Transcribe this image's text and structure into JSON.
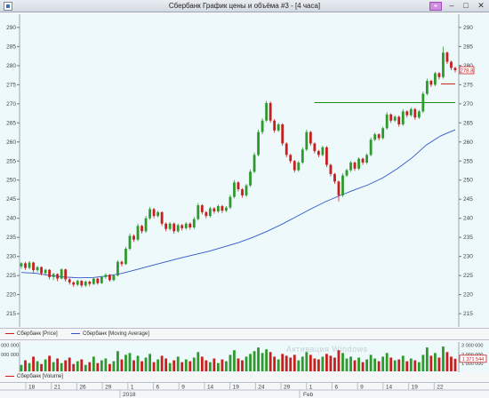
{
  "window": {
    "title": "Сбербанк График цены и объёма #3 - [4 часа]",
    "pin_icon": "pin-icon",
    "buttons": {
      "minimize": "–",
      "maximize": "□",
      "close": "✕"
    }
  },
  "colors": {
    "background": "#edf9fb",
    "up": "#2e9a2e",
    "down": "#c81e1e",
    "moving_average": "#3355cc",
    "level_line": "#1a8a1a",
    "price_label": "#c81e1e"
  },
  "legend": {
    "price": "Сбербанк [Price]",
    "moving_average": "Сбербанк [Moving Average]",
    "volume": "Сбербанк [Volume]"
  },
  "watermark": "Активация Windows",
  "price_axis": {
    "ticks": [
      "290",
      "285",
      "280",
      "275",
      "270",
      "265",
      "260",
      "255",
      "250",
      "245",
      "240",
      "235",
      "230",
      "225",
      "220",
      "215"
    ],
    "current_price": "278.8"
  },
  "volume_axis": {
    "right_ticks": [
      "3 000 000",
      "2 000 000",
      "1 000 000"
    ],
    "left_ticks": [
      "3 000 000",
      "2 000 000"
    ],
    "current_volume": "1 371 544"
  },
  "time_axis": {
    "day_labels": [
      "18",
      "21",
      "26",
      "29",
      "1",
      "6",
      "9",
      "14",
      "19",
      "24",
      "29",
      "1",
      "6",
      "9",
      "14",
      "19",
      "22"
    ],
    "year_label": "2018",
    "month_label": "Feb"
  },
  "chart_data": [
    {
      "type": "candlestick",
      "title": "",
      "ylim": [
        212,
        293
      ],
      "moving_average": [
        [
          0,
          225.8
        ],
        [
          10,
          225.6
        ],
        [
          20,
          225.0
        ],
        [
          30,
          224.6
        ],
        [
          40,
          224.4
        ],
        [
          50,
          224.5
        ],
        [
          60,
          224.9
        ],
        [
          70,
          225.6
        ],
        [
          80,
          226.6
        ],
        [
          90,
          227.6
        ],
        [
          100,
          228.6
        ],
        [
          110,
          229.6
        ],
        [
          120,
          230.5
        ],
        [
          130,
          231.4
        ],
        [
          140,
          232.5
        ],
        [
          150,
          233.6
        ],
        [
          160,
          235.0
        ],
        [
          170,
          236.6
        ],
        [
          180,
          238.4
        ],
        [
          190,
          240.4
        ],
        [
          200,
          242.4
        ],
        [
          210,
          244.3
        ],
        [
          220,
          245.9
        ],
        [
          230,
          247.4
        ],
        [
          240,
          248.8
        ],
        [
          250,
          250.6
        ],
        [
          260,
          253.0
        ],
        [
          270,
          255.8
        ],
        [
          280,
          259.2
        ],
        [
          290,
          261.6
        ],
        [
          300,
          263.2
        ]
      ],
      "levels": [
        {
          "from": 206,
          "to": 305,
          "value": 270.3
        },
        {
          "from": 295,
          "to": 305,
          "value": 275.2
        }
      ],
      "candles": [
        [
          0,
          227.4,
          228.2,
          226.8,
          228.5
        ],
        [
          1,
          228.2,
          227.0,
          226.5,
          228.6
        ],
        [
          2,
          227.0,
          228.4,
          226.6,
          228.8
        ],
        [
          3,
          228.4,
          226.4,
          225.8,
          228.6
        ],
        [
          4,
          226.4,
          227.2,
          225.9,
          227.5
        ],
        [
          5,
          227.2,
          225.6,
          225.0,
          227.4
        ],
        [
          6,
          225.6,
          226.5,
          225.0,
          226.8
        ],
        [
          7,
          226.5,
          224.6,
          224.0,
          226.7
        ],
        [
          8,
          224.6,
          225.4,
          223.8,
          225.7
        ],
        [
          9,
          225.4,
          224.2,
          223.5,
          225.6
        ],
        [
          10,
          224.2,
          226.6,
          224.0,
          226.9
        ],
        [
          11,
          226.6,
          224.0,
          223.4,
          226.8
        ],
        [
          12,
          224.0,
          223.2,
          222.6,
          224.3
        ],
        [
          13,
          223.2,
          222.6,
          222.0,
          223.5
        ],
        [
          14,
          222.6,
          223.6,
          222.2,
          223.9
        ],
        [
          15,
          223.6,
          222.4,
          221.9,
          223.8
        ],
        [
          16,
          222.4,
          223.4,
          222.0,
          223.7
        ],
        [
          17,
          223.4,
          222.8,
          222.2,
          223.6
        ],
        [
          18,
          222.8,
          224.2,
          222.5,
          224.5
        ],
        [
          19,
          224.2,
          223.0,
          222.6,
          224.4
        ],
        [
          20,
          223.0,
          224.6,
          222.8,
          224.9
        ],
        [
          21,
          224.6,
          225.2,
          224.1,
          225.6
        ],
        [
          22,
          225.2,
          223.8,
          223.4,
          225.4
        ],
        [
          23,
          223.8,
          225.0,
          223.5,
          225.3
        ],
        [
          24,
          225.0,
          228.6,
          224.8,
          229.0
        ],
        [
          25,
          228.6,
          228.0,
          227.4,
          228.9
        ],
        [
          26,
          228.0,
          232.0,
          227.8,
          232.5
        ],
        [
          27,
          232.0,
          235.4,
          231.6,
          236.0
        ],
        [
          28,
          235.4,
          234.4,
          233.8,
          235.8
        ],
        [
          29,
          234.4,
          238.0,
          234.0,
          238.6
        ],
        [
          30,
          238.0,
          236.6,
          236.0,
          238.3
        ],
        [
          31,
          236.6,
          240.0,
          236.2,
          240.6
        ],
        [
          32,
          240.0,
          242.4,
          239.6,
          243.0
        ],
        [
          33,
          242.4,
          240.6,
          240.0,
          242.7
        ],
        [
          34,
          240.6,
          241.6,
          240.2,
          242.0
        ],
        [
          35,
          241.6,
          238.6,
          238.0,
          241.8
        ],
        [
          36,
          238.6,
          237.2,
          236.6,
          238.9
        ],
        [
          37,
          237.2,
          238.6,
          236.8,
          239.0
        ],
        [
          38,
          238.6,
          236.6,
          236.0,
          238.9
        ],
        [
          39,
          236.6,
          238.2,
          236.2,
          238.6
        ],
        [
          40,
          238.2,
          237.4,
          236.8,
          238.5
        ],
        [
          41,
          237.4,
          238.6,
          237.0,
          239.0
        ],
        [
          42,
          238.6,
          237.6,
          237.0,
          238.9
        ],
        [
          43,
          237.6,
          239.8,
          237.2,
          240.3
        ],
        [
          44,
          239.8,
          243.4,
          239.4,
          244.0
        ],
        [
          45,
          243.4,
          241.6,
          241.0,
          243.7
        ],
        [
          46,
          241.6,
          240.6,
          240.0,
          241.9
        ],
        [
          47,
          240.6,
          242.6,
          240.2,
          243.0
        ],
        [
          48,
          242.6,
          241.8,
          241.2,
          242.9
        ],
        [
          49,
          241.8,
          243.2,
          241.4,
          243.6
        ],
        [
          50,
          243.2,
          242.0,
          241.4,
          243.5
        ],
        [
          51,
          242.0,
          242.8,
          241.6,
          243.2
        ],
        [
          52,
          242.8,
          245.6,
          242.4,
          246.2
        ],
        [
          53,
          245.6,
          249.4,
          245.2,
          250.0
        ],
        [
          54,
          249.4,
          247.6,
          247.0,
          249.7
        ],
        [
          55,
          247.6,
          246.0,
          245.4,
          247.9
        ],
        [
          56,
          246.0,
          248.6,
          245.6,
          249.0
        ],
        [
          57,
          248.6,
          252.2,
          248.2,
          252.8
        ],
        [
          58,
          252.2,
          256.6,
          251.8,
          257.2
        ],
        [
          59,
          256.6,
          262.6,
          256.2,
          263.2
        ],
        [
          60,
          262.6,
          265.6,
          262.0,
          266.2
        ],
        [
          61,
          265.6,
          270.2,
          265.2,
          270.8
        ],
        [
          62,
          270.2,
          265.6,
          265.0,
          270.6
        ],
        [
          63,
          265.6,
          263.0,
          262.4,
          266.0
        ],
        [
          64,
          263.0,
          264.6,
          262.6,
          265.0
        ],
        [
          65,
          264.6,
          259.6,
          259.0,
          264.9
        ],
        [
          66,
          259.6,
          256.6,
          256.0,
          259.9
        ],
        [
          67,
          256.6,
          255.0,
          254.4,
          256.9
        ],
        [
          68,
          255.0,
          252.6,
          252.0,
          255.3
        ],
        [
          69,
          252.6,
          254.6,
          252.2,
          255.0
        ],
        [
          70,
          254.6,
          258.0,
          254.2,
          258.6
        ],
        [
          71,
          258.0,
          262.6,
          257.6,
          263.2
        ],
        [
          72,
          262.6,
          259.6,
          259.0,
          262.9
        ],
        [
          73,
          259.6,
          257.6,
          257.0,
          259.9
        ],
        [
          74,
          257.6,
          256.6,
          256.0,
          257.9
        ],
        [
          75,
          256.6,
          258.6,
          256.2,
          259.0
        ],
        [
          76,
          258.6,
          254.0,
          253.4,
          258.9
        ],
        [
          77,
          254.0,
          251.6,
          251.0,
          254.3
        ],
        [
          78,
          251.6,
          249.6,
          249.0,
          251.9
        ],
        [
          79,
          249.6,
          246.0,
          244.4,
          249.9
        ],
        [
          80,
          246.0,
          251.2,
          245.6,
          251.8
        ],
        [
          81,
          251.2,
          252.6,
          250.8,
          253.0
        ],
        [
          82,
          252.6,
          254.6,
          252.2,
          255.0
        ],
        [
          83,
          254.6,
          253.0,
          252.4,
          254.9
        ],
        [
          84,
          253.0,
          255.6,
          252.6,
          256.0
        ],
        [
          85,
          255.6,
          254.6,
          254.0,
          255.9
        ],
        [
          86,
          254.6,
          256.6,
          254.2,
          257.0
        ],
        [
          87,
          256.6,
          260.6,
          256.2,
          261.2
        ],
        [
          88,
          260.6,
          262.0,
          260.2,
          262.4
        ],
        [
          89,
          262.0,
          261.0,
          260.4,
          262.3
        ],
        [
          90,
          261.0,
          263.6,
          260.6,
          264.0
        ],
        [
          91,
          263.6,
          267.2,
          263.2,
          267.8
        ],
        [
          92,
          267.2,
          265.6,
          265.0,
          267.5
        ],
        [
          93,
          265.6,
          266.6,
          265.2,
          267.0
        ],
        [
          94,
          266.6,
          264.6,
          264.0,
          266.9
        ],
        [
          95,
          264.6,
          268.0,
          264.2,
          268.6
        ],
        [
          96,
          268.0,
          267.0,
          266.4,
          268.3
        ],
        [
          97,
          267.0,
          268.6,
          266.6,
          269.0
        ],
        [
          98,
          268.6,
          266.4,
          265.8,
          268.9
        ],
        [
          99,
          266.4,
          268.0,
          266.0,
          268.4
        ],
        [
          100,
          268.0,
          272.6,
          267.6,
          273.2
        ],
        [
          101,
          272.6,
          276.0,
          272.2,
          276.6
        ],
        [
          102,
          276.0,
          275.0,
          274.4,
          276.3
        ],
        [
          103,
          275.0,
          278.0,
          274.6,
          278.4
        ],
        [
          104,
          278.0,
          277.0,
          276.4,
          278.3
        ],
        [
          105,
          277.0,
          283.4,
          276.6,
          285.0
        ],
        [
          106,
          283.4,
          281.0,
          280.4,
          283.7
        ],
        [
          107,
          281.0,
          279.4,
          278.8,
          281.3
        ],
        [
          108,
          279.4,
          278.8,
          278.2,
          279.7
        ]
      ]
    },
    {
      "type": "bar",
      "title": "",
      "ylabel": "Volume",
      "ylim": [
        0,
        3000000
      ],
      "values": [
        700000,
        1200000,
        900000,
        1600000,
        1100000,
        800000,
        1300000,
        1700000,
        1000000,
        1400000,
        900000,
        1200000,
        1500000,
        800000,
        1100000,
        1300000,
        700000,
        1000000,
        1600000,
        900000,
        1200000,
        1400000,
        800000,
        1100000,
        2200000,
        1300000,
        1800000,
        2000000,
        1200000,
        1700000,
        1100000,
        1500000,
        1900000,
        1000000,
        1300000,
        1700000,
        1400000,
        900000,
        1200000,
        1600000,
        1000000,
        1300000,
        1100000,
        1500000,
        2100000,
        1600000,
        1200000,
        1000000,
        1400000,
        900000,
        1300000,
        1100000,
        1800000,
        2300000,
        1400000,
        1200000,
        1600000,
        1900000,
        2200000,
        2600000,
        2000000,
        2400000,
        2100000,
        1600000,
        1300000,
        1900000,
        1700000,
        1500000,
        1800000,
        1200000,
        1600000,
        2100000,
        1800000,
        1400000,
        1300000,
        1600000,
        1900000,
        1700000,
        1500000,
        2300000,
        2000000,
        1400000,
        1600000,
        1200000,
        1500000,
        1000000,
        1300000,
        1800000,
        1400000,
        1100000,
        1600000,
        2000000,
        1500000,
        1200000,
        1300000,
        1700000,
        1100000,
        1400000,
        1200000,
        1000000,
        1800000,
        2600000,
        1700000,
        2000000,
        1500000,
        2700000,
        2100000,
        1600000,
        1371544
      ]
    }
  ]
}
